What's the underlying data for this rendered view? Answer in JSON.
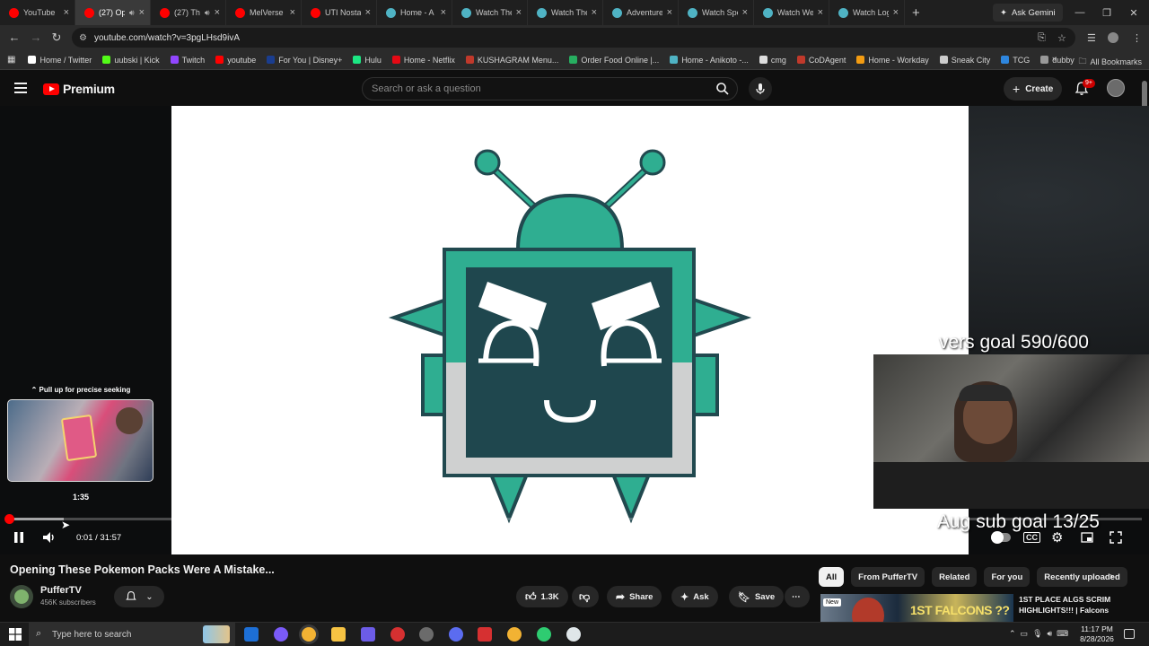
{
  "browser": {
    "tabs": [
      {
        "title": "YouTube",
        "color": "#ff0000"
      },
      {
        "title": "(27) Op",
        "color": "#ff0000",
        "active": true,
        "audio": true
      },
      {
        "title": "(27) Th",
        "color": "#ff0000",
        "audio": true
      },
      {
        "title": "MelVerse",
        "color": "#ff0000"
      },
      {
        "title": "UTI Nostal",
        "color": "#ff0000"
      },
      {
        "title": "Home - A",
        "color": "#4fb3c4"
      },
      {
        "title": "Watch The",
        "color": "#4fb3c4"
      },
      {
        "title": "Watch The",
        "color": "#4fb3c4"
      },
      {
        "title": "Adventure",
        "color": "#4fb3c4"
      },
      {
        "title": "Watch Spe",
        "color": "#4fb3c4"
      },
      {
        "title": "Watch We",
        "color": "#4fb3c4"
      },
      {
        "title": "Watch Log",
        "color": "#4fb3c4"
      }
    ],
    "new_tab": "+",
    "gemini_label": "Ask Gemini",
    "url": "youtube.com/watch?v=3pgLHsd9ivA",
    "bookmarks": [
      {
        "label": "Home / Twitter",
        "color": "#ffffff"
      },
      {
        "label": "uubski | Kick",
        "color": "#53fc18"
      },
      {
        "label": "Twitch",
        "color": "#9146ff"
      },
      {
        "label": "youtube",
        "color": "#ff0000"
      },
      {
        "label": "For You | Disney+",
        "color": "#1a3d8f"
      },
      {
        "label": "Hulu",
        "color": "#1ce783"
      },
      {
        "label": "Home - Netflix",
        "color": "#e50914"
      },
      {
        "label": "KUSHAGRAM Menu...",
        "color": "#c0392b"
      },
      {
        "label": "Order Food Online |...",
        "color": "#27ae60"
      },
      {
        "label": "Home - Anikoto -...",
        "color": "#4fb3c4"
      },
      {
        "label": "cmg",
        "color": "#dddddd"
      },
      {
        "label": "CoDAgent",
        "color": "#c0392b"
      },
      {
        "label": "Home - Workday",
        "color": "#f39c12"
      },
      {
        "label": "Sneak City",
        "color": "#cccccc"
      },
      {
        "label": "TCG",
        "color": "#2e86de"
      },
      {
        "label": "dubby",
        "color": "#999999"
      }
    ],
    "all_bookmarks": "All Bookmarks"
  },
  "youtube": {
    "logo_text": "Premium",
    "search_placeholder": "Search or ask a question",
    "create_label": "Create",
    "notification_count": "9+"
  },
  "player": {
    "overlay_top": "vers goal 590/600",
    "overlay_bottom": "Aug sub goal 13/25",
    "seek_hint": "⌃ Pull up for precise seeking",
    "preview_time": "1:35",
    "current_time": "0:01 / 31:57",
    "played_fraction": 0.0005,
    "buffered_fraction": 0.05
  },
  "video": {
    "title": "Opening These Pokemon Packs Were A Mistake...",
    "channel": "PufferTV",
    "subscribers": "456K subscribers",
    "likes": "1.3K",
    "share_label": "Share",
    "ask_label": "Ask",
    "save_label": "Save"
  },
  "sidebar": {
    "chips": [
      "All",
      "From PufferTV",
      "Related",
      "For you",
      "Recently uploaded"
    ],
    "rec_badge": "New",
    "rec_title": "1ST PLACE ALGS SCRIM HIGHLIGHTS!!! | Falcons"
  },
  "taskbar": {
    "search_placeholder": "Type here to search",
    "time": "11:17 PM",
    "date": "8/28/2026"
  }
}
